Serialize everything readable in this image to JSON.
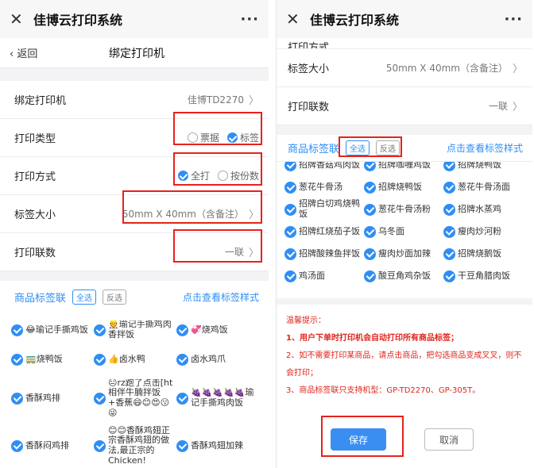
{
  "app_title": "佳博云打印系统",
  "more_icon": "···",
  "close_icon": "✕",
  "left": {
    "nav": {
      "back": "返回",
      "title": "绑定打印机"
    },
    "rows": {
      "printer": {
        "label": "绑定打印机",
        "value": "佳博TD2270"
      },
      "print_type": {
        "label": "打印类型",
        "options": [
          "票据",
          "标签"
        ],
        "selected": "标签"
      },
      "print_mode": {
        "label": "打印方式",
        "options": [
          "全打",
          "按份数"
        ],
        "selected": "全打"
      },
      "label_size": {
        "label": "标签大小",
        "value": "50mm X 40mm（含备注）"
      },
      "copies": {
        "label": "打印联数",
        "value": "一联"
      }
    },
    "goods": {
      "title": "商品标签联",
      "select_all": "全选",
      "invert": "反选",
      "style_link": "点击查看标签样式",
      "items": [
        "😂瑜记手撕鸡饭",
        "👷瑜记手撕鸡肉香拌饭",
        "💞烧鸡饭",
        "🚃烧鸭饭",
        "👍卤水鸭",
        "卤水鸡爪",
        "香酥鸡排",
        "😐rz跑了点击[ht相伴牛腩拌饭+香蕉😄😊😍😗😜",
        "🍇🍇🍇🍇🍇瑜记手撕鸡肉饭",
        "香酥闷鸡排",
        "😊😊香酥鸡翅正宗香酥鸡翅的做法,最正宗的Chicken!",
        "香酥鸡翅加辣"
      ]
    }
  },
  "right": {
    "rows": {
      "cut_off": {
        "label": "打印方式"
      },
      "label_size": {
        "label": "标签大小",
        "value": "50mm X 40mm（含备注）"
      },
      "copies": {
        "label": "打印联数",
        "value": "一联"
      }
    },
    "goods": {
      "title": "商品标签联",
      "select_all": "全选",
      "invert": "反选",
      "style_link": "点击查看标签样式",
      "items": [
        "招牌香菇鸡肉饭",
        "招牌咖喱鸡饭",
        "招牌烧鸭饭",
        "葱花牛骨汤",
        "招牌烧鸭饭",
        "葱花牛骨汤面",
        "招牌白切鸡烧鸭饭",
        "葱花牛骨汤粉",
        "招牌水蒸鸡",
        "招牌红烧茄子饭",
        "乌冬面",
        "瘦肉炒河粉",
        "招牌酸辣鱼拌饭",
        "瘦肉炒面加辣",
        "招牌烧鹅饭",
        "鸡汤面",
        "酸豆角鸡杂饭",
        "干豆角腊肉饭"
      ]
    },
    "tips": {
      "title": "温馨提示：",
      "lines": [
        "1、用户下单时打印机会自动打印所有商品标签；",
        "2、如不需要打印某商品，请点击商品，把勾选商品变成叉叉，则不会打印；",
        "3、商品标签联只支持机型：GP-TD2270、GP-305T。"
      ]
    },
    "buttons": {
      "save": "保存",
      "cancel": "取消"
    }
  },
  "colors": {
    "accent": "#2f8ef4",
    "highlight": "#e8211b",
    "warning_text": "#e0241b"
  }
}
